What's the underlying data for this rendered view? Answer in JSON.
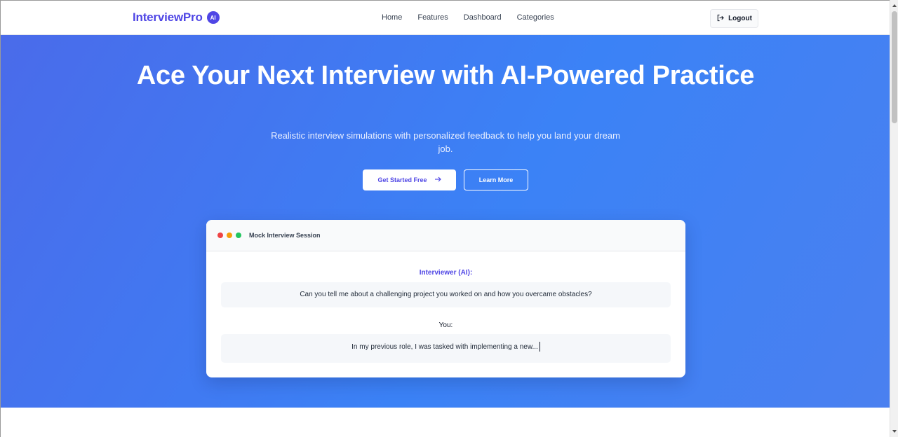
{
  "nav": {
    "brand": "InterviewPro",
    "brand_badge": "AI",
    "links": [
      "Home",
      "Features",
      "Dashboard",
      "Categories"
    ],
    "logout_label": "Logout"
  },
  "hero": {
    "title": "Ace Your Next Interview with AI-Powered Practice",
    "subtitle": "Realistic interview simulations with personalized feedback to help you land your dream job.",
    "primary_button": "Get Started Free",
    "secondary_button": "Learn More"
  },
  "mock": {
    "window_title": "Mock Interview Session",
    "interviewer_label": "Interviewer (AI):",
    "interviewer_message": "Can you tell me about a challenging project you worked on and how you overcame obstacles?",
    "user_label": "You:",
    "user_message": "In my previous role, I was tasked with implementing a new..."
  },
  "colors": {
    "brand": "#4f46e5",
    "hero_gradient_start": "#4a6bea",
    "hero_gradient_end": "#3b82f6"
  },
  "icons": {
    "logout": "logout-icon",
    "arrow": "arrow-right-icon"
  }
}
